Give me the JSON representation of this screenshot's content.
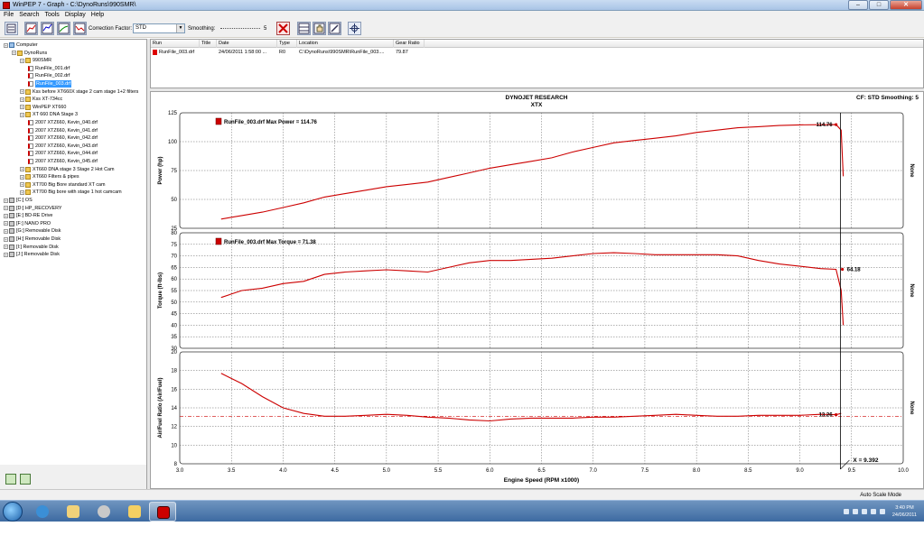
{
  "window": {
    "title": "WinPEP 7  -  Graph - C:\\DynoRuns\\990SMR\\"
  },
  "menu": [
    "File",
    "Search",
    "Tools",
    "Display",
    "Help"
  ],
  "toolbar": {
    "correction_label": "Correction Factor:",
    "correction_value": "STD",
    "smoothing_label": "Smoothing:",
    "smoothing_value": "5"
  },
  "tree": [
    {
      "label": "Computer",
      "icon": "computer-icon",
      "level": 0
    },
    {
      "label": "DynoRuns",
      "icon": "folder-icon",
      "level": 1
    },
    {
      "label": "990SMR",
      "icon": "folder-icon",
      "level": 2
    },
    {
      "label": "RunFile_001.drf",
      "icon": "run-file-icon",
      "level": 3
    },
    {
      "label": "RunFile_002.drf",
      "icon": "run-file-icon",
      "level": 3
    },
    {
      "label": "RunFile_003.drf",
      "icon": "run-file-icon",
      "level": 3,
      "selected": true
    },
    {
      "label": "Kss before XT660X stage 2 cam stage 1+2 filters",
      "icon": "folder-icon",
      "level": 2
    },
    {
      "label": "Kss XT-734cc",
      "icon": "folder-icon",
      "level": 2
    },
    {
      "label": "WinPEP XT660",
      "icon": "folder-icon",
      "level": 2
    },
    {
      "label": "XT 660 DNA Stage 3",
      "icon": "folder-icon",
      "level": 2
    },
    {
      "label": "2007 XTZ660, Kevin_040.drf",
      "icon": "run-file-icon",
      "level": 3
    },
    {
      "label": "2007 XTZ660, Kevin_041.drf",
      "icon": "run-file-icon",
      "level": 3
    },
    {
      "label": "2007 XTZ660, Kevin_042.drf",
      "icon": "run-file-icon",
      "level": 3
    },
    {
      "label": "2007 XTZ660, Kevin_043.drf",
      "icon": "run-file-icon",
      "level": 3
    },
    {
      "label": "2007 XTZ660, Kevin_044.drf",
      "icon": "run-file-icon",
      "level": 3
    },
    {
      "label": "2007 XTZ660, Kevin_045.drf",
      "icon": "run-file-icon",
      "level": 3
    },
    {
      "label": "XT660 DNA stage 3 Stage 2 Hot Cam",
      "icon": "folder-icon",
      "level": 2
    },
    {
      "label": "XT660 Filters & pipes",
      "icon": "folder-icon",
      "level": 2
    },
    {
      "label": "XT700 Big Bore standard XT cam",
      "icon": "folder-icon",
      "level": 2
    },
    {
      "label": "XT700 Big bore with stage 1 hot camcam",
      "icon": "folder-icon",
      "level": 2
    },
    {
      "label": "[C:]  OS",
      "icon": "drive-icon",
      "level": 0
    },
    {
      "label": "[D:]  HP_RECOVERY",
      "icon": "drive-icon",
      "level": 0
    },
    {
      "label": "[E:]  BD-RE Drive",
      "icon": "drive-icon",
      "level": 0
    },
    {
      "label": "[F:]  NANO PRO",
      "icon": "drive-icon",
      "level": 0
    },
    {
      "label": "[G:]  Removable Disk",
      "icon": "drive-icon",
      "level": 0
    },
    {
      "label": "[H:]  Removable Disk",
      "icon": "drive-icon",
      "level": 0
    },
    {
      "label": "[I:]  Removable Disk",
      "icon": "drive-icon",
      "level": 0
    },
    {
      "label": "[J:]  Removable Disk",
      "icon": "drive-icon",
      "level": 0
    }
  ],
  "runtable": {
    "headers": [
      "Run",
      "Title",
      "Date",
      "Type",
      "Location",
      "Gear Ratio"
    ],
    "rows": [
      [
        "RunFile_003.drf",
        "",
        "24/06/2011 1:58:00 ...",
        "R0",
        "C:\\DynoRuns\\990SMR\\RunFile_003....",
        "79.87"
      ]
    ]
  },
  "graph": {
    "header_title": "DYNOJET RESEARCH",
    "header_subtitle": "XTX",
    "header_right": "CF: STD  Smoothing: 5",
    "right_label": "None",
    "cursor_readout": "X = 9.392",
    "series_color": "#cc0000"
  },
  "chart_data": [
    {
      "type": "line",
      "title": "RunFile_003.drf Max Power = 114.76",
      "xlabel": "Engine Speed (RPM x1000)",
      "ylabel": "Power (hp)",
      "xlim": [
        3.0,
        10.0
      ],
      "ylim": [
        25,
        125
      ],
      "yticks": [
        25,
        50,
        75,
        100,
        125
      ],
      "grid": true,
      "annotation": "114.76",
      "x": [
        3.4,
        3.6,
        3.8,
        4.0,
        4.2,
        4.4,
        4.6,
        4.8,
        5.0,
        5.2,
        5.4,
        5.6,
        5.8,
        6.0,
        6.2,
        6.4,
        6.6,
        6.8,
        7.0,
        7.2,
        7.4,
        7.6,
        7.8,
        8.0,
        8.2,
        8.4,
        8.6,
        8.8,
        9.0,
        9.2,
        9.35,
        9.4,
        9.42
      ],
      "y": [
        33,
        36,
        39,
        43,
        47,
        52,
        55,
        58,
        61,
        63,
        65,
        69,
        73,
        77,
        80,
        83,
        86,
        91,
        95,
        99,
        101,
        103,
        105,
        108,
        110,
        112,
        113,
        114,
        114.5,
        114.7,
        114.76,
        110,
        70
      ]
    },
    {
      "type": "line",
      "title": "RunFile_003.drf Max Torque = 71.38",
      "ylabel": "Torque (ft-lbs)",
      "xlim": [
        3.0,
        10.0
      ],
      "ylim": [
        30,
        80
      ],
      "yticks": [
        30,
        35,
        40,
        45,
        50,
        55,
        60,
        65,
        70,
        75,
        80
      ],
      "grid": true,
      "annotation": "64.18",
      "x": [
        3.4,
        3.6,
        3.8,
        4.0,
        4.2,
        4.4,
        4.6,
        4.8,
        5.0,
        5.2,
        5.4,
        5.6,
        5.8,
        6.0,
        6.2,
        6.4,
        6.6,
        6.8,
        7.0,
        7.2,
        7.4,
        7.6,
        7.8,
        8.0,
        8.2,
        8.4,
        8.6,
        8.8,
        9.0,
        9.2,
        9.35,
        9.4,
        9.42
      ],
      "y": [
        52,
        55,
        56,
        58,
        59,
        62,
        63,
        63.5,
        64,
        63.5,
        63,
        65,
        67,
        68,
        68,
        68.5,
        69,
        70,
        71,
        71.38,
        71,
        70.5,
        70.5,
        70.5,
        70.5,
        70,
        68,
        66.5,
        65.5,
        64.5,
        64.18,
        55,
        40
      ]
    },
    {
      "type": "line",
      "ylabel": "Air/Fuel Ratio (Air/Fuel)",
      "xlim": [
        3.0,
        10.0
      ],
      "ylim": [
        8,
        20
      ],
      "yticks": [
        8,
        10,
        12,
        14,
        16,
        18,
        20
      ],
      "xticks": [
        3.0,
        3.5,
        4.0,
        4.5,
        5.0,
        5.5,
        6.0,
        6.5,
        7.0,
        7.5,
        8.0,
        8.5,
        9.0,
        9.5,
        10.0
      ],
      "grid": true,
      "reference_line": 13.1,
      "annotation": "13.26",
      "x": [
        3.4,
        3.6,
        3.8,
        4.0,
        4.2,
        4.4,
        4.6,
        4.8,
        5.0,
        5.2,
        5.4,
        5.6,
        5.8,
        6.0,
        6.2,
        6.4,
        6.6,
        6.8,
        7.0,
        7.2,
        7.4,
        7.6,
        7.8,
        8.0,
        8.2,
        8.4,
        8.6,
        8.8,
        9.0,
        9.2,
        9.35,
        9.4
      ],
      "y": [
        17.7,
        16.6,
        15.2,
        14.0,
        13.4,
        13.1,
        13.1,
        13.2,
        13.3,
        13.2,
        13.0,
        12.9,
        12.7,
        12.6,
        12.8,
        12.9,
        12.9,
        12.9,
        13.0,
        13.0,
        13.1,
        13.2,
        13.3,
        13.2,
        13.1,
        13.1,
        13.2,
        13.2,
        13.2,
        13.3,
        13.26,
        13.4
      ]
    }
  ],
  "statusbar": {
    "mode": "Auto Scale Mode"
  },
  "taskbar": {
    "time": "3:40 PM",
    "date": "24/06/2011"
  }
}
